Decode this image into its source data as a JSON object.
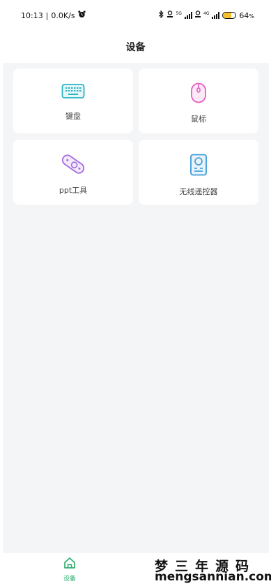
{
  "status_bar": {
    "time": "10:13",
    "network_speed": "0.0K/s",
    "network_type_1": "5G",
    "network_type_2": "4G",
    "battery_percent": "64",
    "battery_level": 0.64,
    "battery_fill_color": "#f2c030"
  },
  "header": {
    "title": "设备"
  },
  "devices": [
    {
      "label": "键盘",
      "icon": "keyboard-icon",
      "color": "#2ab5c0"
    },
    {
      "label": "鼠标",
      "icon": "mouse-icon",
      "color": "#e35fc4"
    },
    {
      "label": "ppt工具",
      "icon": "ppt-remote-icon",
      "color": "#a46be0"
    },
    {
      "label": "无线遥控器",
      "icon": "remote-control-icon",
      "color": "#3a9bd6"
    }
  ],
  "tab_bar": {
    "tabs": [
      {
        "label": "设备",
        "icon": "home-icon",
        "active": true,
        "color": "#2fae6f"
      }
    ]
  },
  "watermark": {
    "line1": "梦三年源码",
    "line2": "mengsannian.com"
  }
}
